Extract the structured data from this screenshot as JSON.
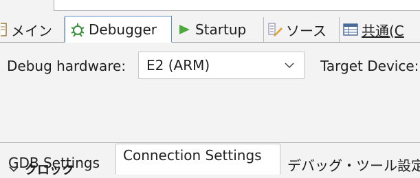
{
  "main_tabs": [
    {
      "label": "メイン",
      "icon": "document-icon"
    },
    {
      "label": "Debugger",
      "icon": "bug-icon"
    },
    {
      "label": "Startup",
      "icon": "play-icon"
    },
    {
      "label": "ソース",
      "icon": "source-icon"
    },
    {
      "label": "共通(C",
      "icon": "table-icon"
    }
  ],
  "debug_hardware": {
    "label": "Debug hardware:",
    "selected": "E2 (ARM)"
  },
  "target_device_label": "Target Device:",
  "sub_tabs": [
    "GDB Settings",
    "Connection Settings",
    "デバッグ・ツール設定"
  ],
  "section": {
    "label": "クロック"
  },
  "colors": {
    "active_tab_border": "#5a8fd0",
    "play_green": "#4caa3c",
    "bug_green": "#3b8f3b"
  }
}
